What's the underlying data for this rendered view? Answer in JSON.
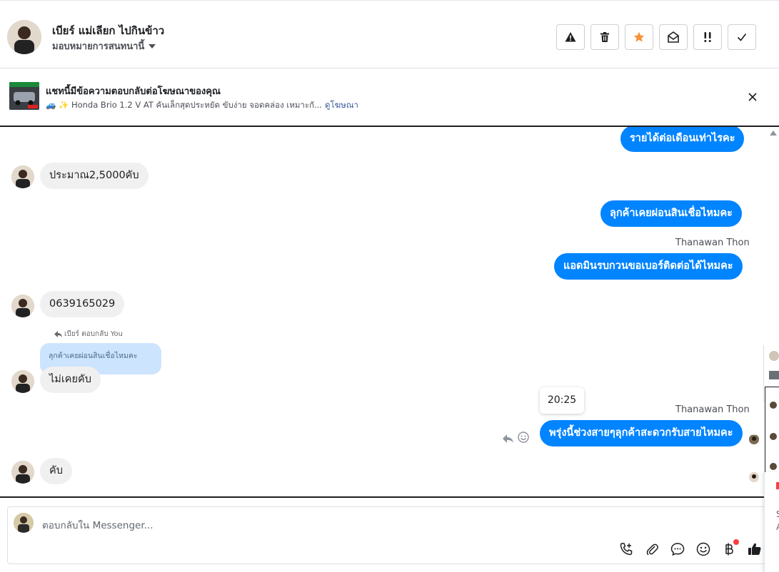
{
  "header": {
    "contact_name": "เบียร์ แม่เลียก ไปกินข้าว",
    "assign_label": "มอบหมายการสนทนานี้",
    "actions": [
      {
        "name": "report-button",
        "icon": "warning-icon"
      },
      {
        "name": "delete-button",
        "icon": "trash-icon"
      },
      {
        "name": "star-button",
        "icon": "star-icon"
      },
      {
        "name": "mark-unread-button",
        "icon": "envelope-open-icon"
      },
      {
        "name": "follow-up-button",
        "icon": "exclamation-icon"
      },
      {
        "name": "done-button",
        "icon": "check-icon"
      }
    ]
  },
  "ad_banner": {
    "title": "แชทนี้มีข้อความตอบกลับต่อโฆษณาของคุณ",
    "subtitle": "🚙 ✨ Honda Brio 1.2 V AT คันเล็กสุดประหยัด ขับง่าย จอดคล่อง เหมาะกั...",
    "link": "ดูโฆษณา"
  },
  "messages": {
    "m1": "รายได้ต่อเดือนเท่าไรคะ",
    "m2": "ประมาณ2,5000คับ",
    "m3": "ลุกค้าเคยผ่อนสินเชื่อไหมคะ",
    "m4_sender": "Thanawan Thon",
    "m4": "แอดมินรบกวนขอเบอร์ติดต่อได้ไหมคะ",
    "m5": "0639165029",
    "m6_reply_note": "เบียร์ ตอบกลับ You",
    "m6_quote": "ลุกค้าเคยผ่อนสินเชื่อไหมคะ",
    "m6": "ไม่เคยคับ",
    "m7_time": "20:25",
    "m7_sender": "Thanawan Thon",
    "m7": "พรุ่งนี้ช่วงสายๆลุกค้าสะดวกรับสายไหมคะ",
    "m8": "คับ"
  },
  "composer": {
    "placeholder": "ตอบกลับใน Messenger..."
  },
  "right_tail": {
    "line1": "S",
    "line2": "A"
  },
  "colors": {
    "outgoing_bubble": "#0084ff",
    "incoming_bubble": "#f0f0f0",
    "star_active": "#f7923b",
    "link": "#385898"
  }
}
